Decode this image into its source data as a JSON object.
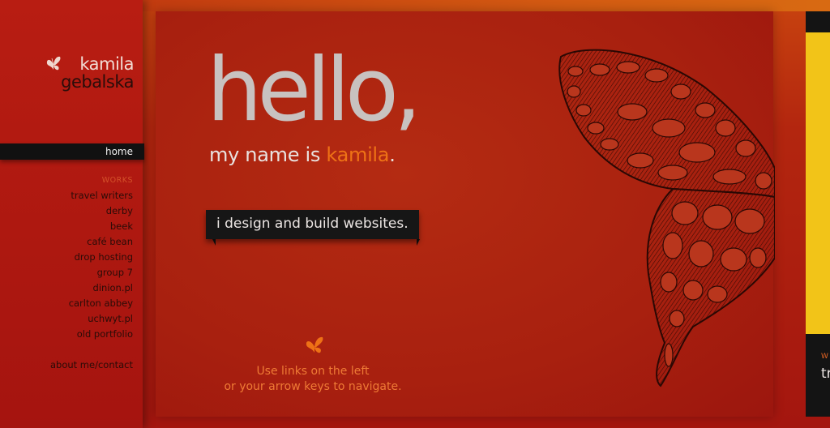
{
  "logo": {
    "first_name": "kamila",
    "last_name": "gebalska",
    "icon": "butterfly-icon"
  },
  "nav": {
    "home_label": "home",
    "works_heading": "WORKS",
    "items": [
      "travel writers",
      "derby",
      "beek",
      "café bean",
      "drop hosting",
      "group 7",
      "dinion.pl",
      "carlton abbey",
      "uchwyt.pl",
      "old portfolio"
    ],
    "about_label": "about me/contact"
  },
  "hero": {
    "hello": "hello,",
    "name_prefix": "my name is ",
    "name_highlight": "kamila",
    "name_suffix": ".",
    "tagline": "i design and build websites."
  },
  "hint": {
    "line1": "Use links on the left",
    "line2": "or your arrow keys to navigate.",
    "icon": "butterfly-icon"
  },
  "next_panel": {
    "works_label": "W",
    "title": "tr"
  },
  "colors": {
    "accent": "#ee7216",
    "background": "#a8200f",
    "dark": "#161616",
    "yellow": "#f2c418"
  }
}
